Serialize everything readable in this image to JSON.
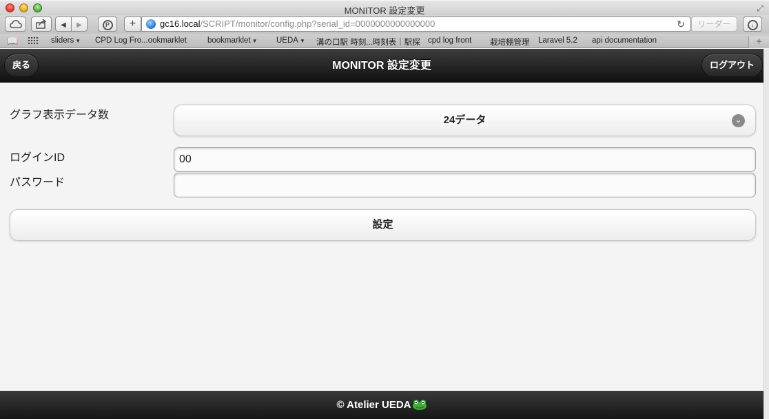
{
  "window": {
    "title": "MONITOR 設定変更"
  },
  "toolbar": {
    "url_host": "gc16.local",
    "url_path": "/SCRIPT/monitor/config.php?serial_id=0000000000000000",
    "reader_label": "リーダー",
    "addtab_label": "+"
  },
  "bookmarks": [
    {
      "label": "sliders",
      "menu": true
    },
    {
      "label": "CPD Log Fro...ookmarklet",
      "menu": false
    },
    {
      "label": "bookmarklet",
      "menu": true
    },
    {
      "label": "UEDA",
      "menu": true
    },
    {
      "label": "溝の口駅 時刻...時刻表｜駅探",
      "menu": false
    },
    {
      "label": "cpd log front",
      "menu": false
    },
    {
      "label": "栽培棚管理",
      "menu": false
    },
    {
      "label": "Laravel 5.2",
      "menu": false
    },
    {
      "label": "api documentation",
      "menu": false
    }
  ],
  "header": {
    "back_label": "戻る",
    "title": "MONITOR 設定変更",
    "logout_label": "ログアウト"
  },
  "form": {
    "graph_count_label": "グラフ表示データ数",
    "graph_count_value": "24データ",
    "login_id_label": "ログインID",
    "login_id_value": "00",
    "password_label": "パスワード",
    "password_value": "",
    "submit_label": "設定"
  },
  "footer": {
    "text": "© Atelier UEDA"
  },
  "colors": {
    "header_bg": "#1e1e1e",
    "frog_green": "#3fae3a"
  }
}
